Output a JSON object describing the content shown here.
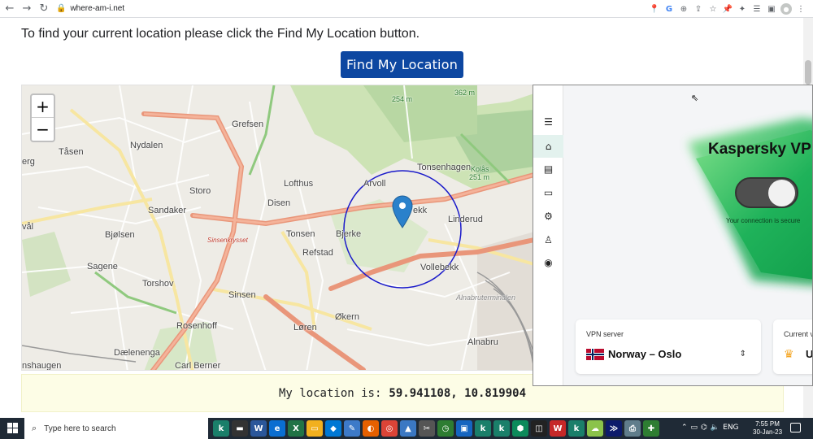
{
  "browser": {
    "url": "where-am-i.net"
  },
  "page": {
    "instruction": "To find your current location please click the Find My Location button.",
    "find_button_label": "Find My Location",
    "result_prefix": "My location is:",
    "result_coords": "59.941108, 10.819904"
  },
  "map": {
    "zoom_in": "+",
    "zoom_out": "−",
    "labels": {
      "grefsen": "Grefsen",
      "nydalen": "Nydalen",
      "tasen": "Tåsen",
      "erg": "erg",
      "lofthus": "Lofthus",
      "storo": "Storo",
      "disen": "Disen",
      "sandaker": "Sandaker",
      "arvoll": "Arvoll",
      "tonsenhagen": "Tonsenhagen",
      "kolas": "Kolås",
      "kolas_elev": "251 m",
      "elev_362": "362 m",
      "elev_254": "254 m",
      "linderud": "Linderud",
      "bjolsen": "Bjølsen",
      "sinsenkrysset": "Sinsenkrysset",
      "tonsen": "Tonsen",
      "bjerke": "Bjerke",
      "refstad": "Refstad",
      "sagene": "Sagene",
      "torshov": "Torshov",
      "vollebekk": "Vollebekk",
      "vaal": "vål",
      "sinsen": "Sinsen",
      "alnabruterminalen": "Alnabruterminalen",
      "okern": "Økern",
      "rosenhoff": "Rosenhoff",
      "loren": "Løren",
      "alnabru": "Alnabru",
      "daelenenga": "Dælenenga",
      "carl_berner": "Carl Berner",
      "haugen": "nshaugen",
      "ekk": "ekk"
    }
  },
  "kaspersky": {
    "title": "Kaspersky VP",
    "status": "Your connection is secure",
    "server_label": "VPN server",
    "server_value": "Norway – Oslo",
    "current_label": "Current v",
    "current_value": "U",
    "accent": "#1fb25a",
    "sidebar_icons": [
      "menu-icon",
      "home-icon",
      "document-icon",
      "devices-icon",
      "gear-icon",
      "user-icon",
      "support-icon"
    ]
  },
  "taskbar": {
    "search_placeholder": "Type here to search",
    "lang": "ENG",
    "time": "7:55 PM",
    "date": "30-Jan-23"
  }
}
